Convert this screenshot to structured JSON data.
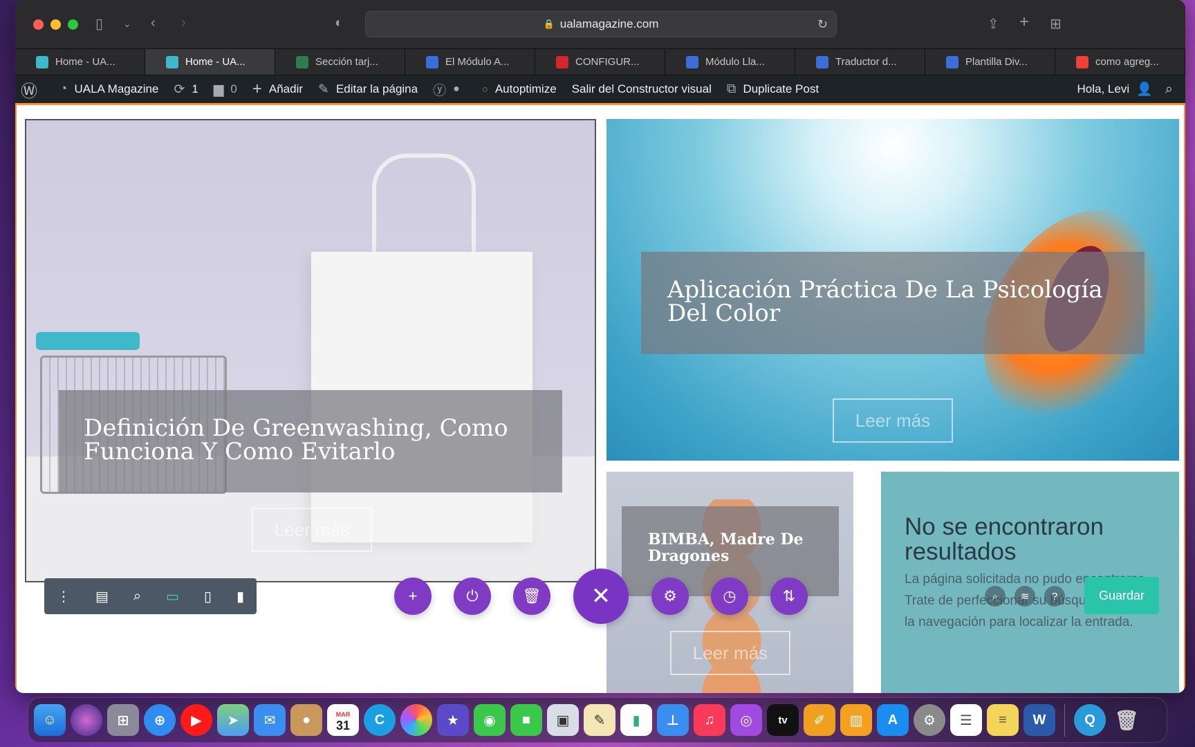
{
  "browser": {
    "url": "ualamagazine.com",
    "tabs": [
      {
        "label": "Home - UA...",
        "favicon_color": "#3fb8c9",
        "active": false
      },
      {
        "label": "Home - UA...",
        "favicon_color": "#3fb8c9",
        "active": true
      },
      {
        "label": "Sección tarj...",
        "favicon_color": "#2e7d4f",
        "active": false
      },
      {
        "label": "El Módulo A...",
        "favicon_color": "#3b6fd8",
        "active": false
      },
      {
        "label": "CONFIGUR...",
        "favicon_color": "#d6262c",
        "active": false
      },
      {
        "label": "Módulo Lla...",
        "favicon_color": "#3b6fd8",
        "active": false
      },
      {
        "label": "Traductor d...",
        "favicon_color": "#3b6fd8",
        "active": false
      },
      {
        "label": "Plantilla Div...",
        "favicon_color": "#3b6fd8",
        "active": false
      },
      {
        "label": "como agreg...",
        "favicon_color": "#ea4335",
        "active": false
      }
    ]
  },
  "adminbar": {
    "site_name": "UALA Magazine",
    "updates_count": "1",
    "comments_count": "0",
    "add_label": "Añadir",
    "edit_label": "Editar la página",
    "autoptimize_label": "Autoptimize",
    "exit_builder_label": "Salir del Constructor visual",
    "duplicate_label": "Duplicate Post",
    "greeting": "Hola, Levi"
  },
  "posts": [
    {
      "title": "Definición De Greenwashing, Como Funciona Y Como Evitarlo",
      "read_more": "Leer más"
    },
    {
      "title": "Aplicación Práctica De La Psicología Del Color",
      "read_more": "Leer más"
    },
    {
      "title": "BIMBA, Madre De Dragones",
      "read_more": "Leer más"
    }
  ],
  "no_results": {
    "title": "No se encontraron resultados",
    "text": "La página solicitada no pudo encontrarse. Trate de perfeccionar su búsqueda o utilice la navegación para localizar la entrada."
  },
  "divi": {
    "save_label": "Guardar",
    "accent": "#7f3bc3",
    "save_color": "#29c4a9"
  },
  "dock": {
    "calendar_month": "MAR",
    "calendar_day": "31",
    "tv_label": "tv"
  }
}
